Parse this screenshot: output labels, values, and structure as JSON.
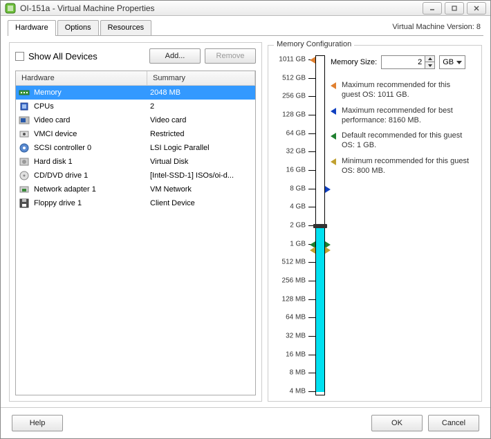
{
  "window": {
    "title": "OI-151a - Virtual Machine Properties",
    "vm_version": "Virtual Machine Version: 8"
  },
  "tabs": {
    "hardware": "Hardware",
    "options": "Options",
    "resources": "Resources"
  },
  "left": {
    "show_all": "Show All Devices",
    "add": "Add...",
    "remove": "Remove",
    "col_hw": "Hardware",
    "col_sm": "Summary",
    "rows": [
      {
        "name": "Memory",
        "summary": "2048 MB"
      },
      {
        "name": "CPUs",
        "summary": "2"
      },
      {
        "name": "Video card",
        "summary": "Video card"
      },
      {
        "name": "VMCI device",
        "summary": "Restricted"
      },
      {
        "name": "SCSI controller 0",
        "summary": "LSI Logic Parallel"
      },
      {
        "name": "Hard disk 1",
        "summary": "Virtual Disk"
      },
      {
        "name": "CD/DVD drive 1",
        "summary": "[Intel-SSD-1] ISOs/oi-d..."
      },
      {
        "name": "Network adapter 1",
        "summary": "VM Network"
      },
      {
        "name": "Floppy drive 1",
        "summary": "Client Device"
      }
    ]
  },
  "right": {
    "legend": "Memory Configuration",
    "memsize_label": "Memory Size:",
    "memsize_value": "2",
    "unit": "GB",
    "scale": [
      "1011 GB",
      "512 GB",
      "256 GB",
      "128 GB",
      "64 GB",
      "32 GB",
      "16 GB",
      "8 GB",
      "4 GB",
      "2 GB",
      "1 GB",
      "512 MB",
      "256 MB",
      "128 MB",
      "64 MB",
      "32 MB",
      "16 MB",
      "8 MB",
      "4 MB"
    ],
    "rec": {
      "max_guest": "Maximum recommended for this guest OS: 1011 GB.",
      "max_perf": "Maximum recommended for best performance: 8160 MB.",
      "default": "Default recommended for this guest OS: 1 GB.",
      "min": "Minimum recommended for this guest OS: 800 MB."
    }
  },
  "footer": {
    "help": "Help",
    "ok": "OK",
    "cancel": "Cancel"
  }
}
